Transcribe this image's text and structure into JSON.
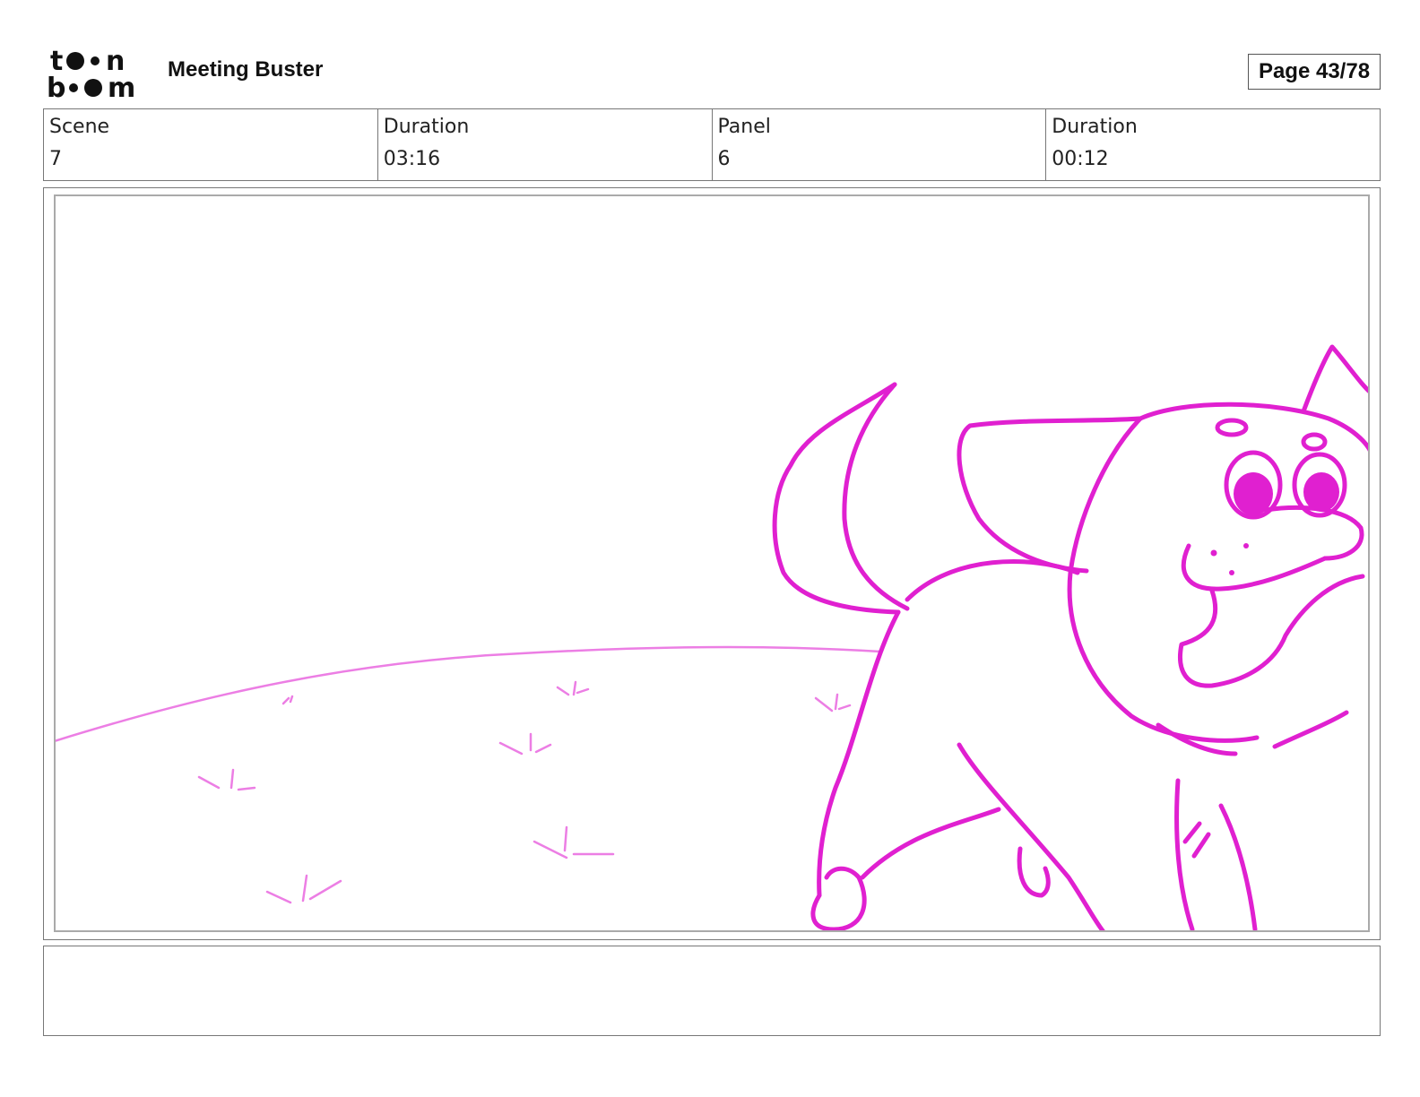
{
  "brand": {
    "logo_text_top": "toon",
    "logo_text_bottom": "boom"
  },
  "header": {
    "title": "Meeting Buster",
    "page_label": "Page 43/78"
  },
  "info": {
    "scene_label": "Scene",
    "scene_value": "7",
    "scene_duration_label": "Duration",
    "scene_duration_value": "03:16",
    "panel_label": "Panel",
    "panel_value": "6",
    "panel_duration_label": "Duration",
    "panel_duration_value": "00:12"
  },
  "drawing": {
    "line_color": "#e020d0",
    "ground_color": "#ec7ee4"
  },
  "caption": {
    "text": ""
  }
}
